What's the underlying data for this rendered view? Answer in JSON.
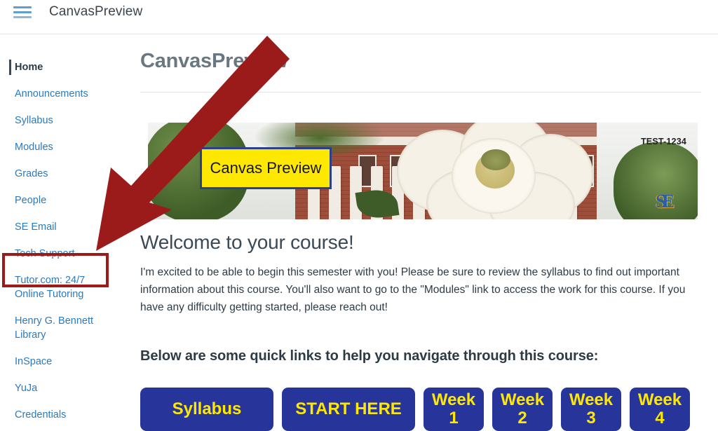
{
  "topbar": {
    "menu_icon": "hamburger-menu-icon",
    "title": "CanvasPreview"
  },
  "sidebar": {
    "items": [
      {
        "label": "Home",
        "active": true
      },
      {
        "label": "Announcements",
        "active": false
      },
      {
        "label": "Syllabus",
        "active": false
      },
      {
        "label": "Modules",
        "active": false
      },
      {
        "label": "Grades",
        "active": false
      },
      {
        "label": "People",
        "active": false
      },
      {
        "label": "SE Email",
        "active": false
      },
      {
        "label": "Tech Support",
        "active": false
      },
      {
        "label": "Tutor.com: 24/7 Online Tutoring",
        "active": false
      },
      {
        "label": "Henry G. Bennett Library",
        "active": false
      },
      {
        "label": "InSpace",
        "active": false
      },
      {
        "label": "YuJa",
        "active": false
      },
      {
        "label": "Credentials",
        "active": false
      }
    ],
    "highlight_target": "Tutor.com: 24/7 Online Tutoring"
  },
  "main": {
    "page_title": "CanvasPreview",
    "banner": {
      "label_text": "Canvas Preview",
      "course_code": "TEST-1234",
      "logo_text": "SE",
      "label_bg_color": "#ffe800",
      "label_border_color": "#2b3f8f"
    },
    "welcome_heading": "Welcome to your course!",
    "welcome_paragraph": "I'm excited to be able to begin this semester with you! Please be sure to review the syllabus to find out important information about this course. You'll also want to go to the \"Modules\" link to access the work for this course. If you have any difficulty getting started, please reach out!",
    "quick_links_heading": "Below are some quick links to help you navigate through this course:",
    "quick_links": [
      {
        "label": "Syllabus",
        "width": 190
      },
      {
        "label": "START HERE",
        "width": 190
      },
      {
        "label": "Week 1",
        "width": 86
      },
      {
        "label": "Week 2",
        "width": 86
      },
      {
        "label": "Week 3",
        "width": 86
      },
      {
        "label": "Week 4",
        "width": 86
      }
    ],
    "button_bg_color": "#27359b",
    "button_text_color": "#ffe800"
  },
  "annotation": {
    "arrow_color": "#9b1b1b",
    "highlight_color": "#9b1b1b",
    "arrow_points_to": "Tutor.com: 24/7 Online Tutoring"
  }
}
